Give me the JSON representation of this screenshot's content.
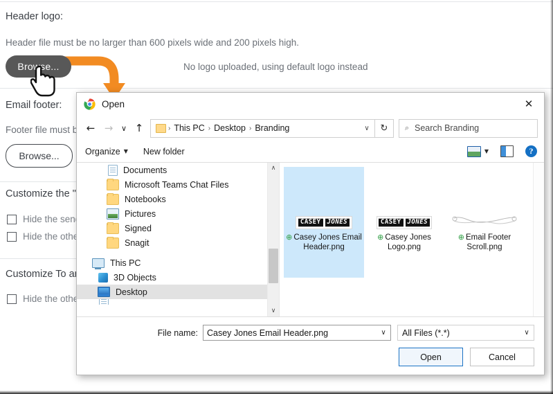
{
  "background_page": {
    "header_logo_label": "Header logo:",
    "header_help_text": "Header file must be no larger than 600 pixels wide and 200 pixels high.",
    "browse_header_label": "Browse...",
    "no_logo_text": "No logo uploaded, using default logo instead",
    "email_footer_label": "Email footer:",
    "footer_help_text": "Footer file must b",
    "browse_footer_label": "Browse...",
    "customize_section1_title": "Customize the \"",
    "checkbox1_label": "Hide the send",
    "checkbox2_label": "Hide the othe",
    "customize_section2_title": "Customize To ar",
    "checkbox3_label": "Hide the othe"
  },
  "dialog": {
    "title": "Open",
    "title_icon": "chrome-logo-icon",
    "close_icon": "✕",
    "nav": {
      "back_icon": "←",
      "forward_icon": "→",
      "recent_icon": "∨",
      "up_icon": "↑",
      "refresh_icon": "↻",
      "dropdown_icon": "∨",
      "breadcrumbs": [
        "This PC",
        "Desktop",
        "Branding"
      ],
      "crumb_separator": "›"
    },
    "search": {
      "icon": "⌕",
      "placeholder": "Search Branding"
    },
    "toolbar": {
      "organize_label": "Organize",
      "organize_caret": "▼",
      "new_folder_label": "New folder",
      "view_icon": "view-layout-icon",
      "view_caret": "▼",
      "preview_pane_icon": "preview-pane-icon",
      "help_icon": "?"
    },
    "nav_pane": {
      "items": [
        {
          "label": "Documents",
          "icon": "document-icon",
          "level": 2,
          "selected": false
        },
        {
          "label": "Microsoft Teams Chat Files",
          "icon": "folder-icon",
          "level": 2,
          "selected": false
        },
        {
          "label": "Notebooks",
          "icon": "folder-icon",
          "level": 2,
          "selected": false
        },
        {
          "label": "Pictures",
          "icon": "picture-folder-icon",
          "level": 2,
          "selected": false
        },
        {
          "label": "Signed",
          "icon": "folder-icon",
          "level": 2,
          "selected": false
        },
        {
          "label": "Snagit",
          "icon": "folder-icon",
          "level": 2,
          "selected": false
        },
        {
          "label": "This PC",
          "icon": "this-pc-icon",
          "level": 1,
          "selected": false
        },
        {
          "label": "3D Objects",
          "icon": "3d-objects-icon",
          "level": 2,
          "selected": false
        },
        {
          "label": "Desktop",
          "icon": "desktop-icon",
          "level": 2,
          "selected": true
        }
      ],
      "scroll_up_icon": "∧",
      "scroll_down_icon": "∨"
    },
    "files": [
      {
        "name": "Casey Jones Email Header.png",
        "selected": true,
        "thumb_type": "logo",
        "thumb_words": [
          "CASEY",
          "JONES"
        ],
        "status_icon": "⊕"
      },
      {
        "name": "Casey Jones Logo.png",
        "selected": false,
        "thumb_type": "logo",
        "thumb_words": [
          "CASEY",
          "JONES"
        ],
        "status_icon": "⊕"
      },
      {
        "name": "Email Footer Scroll.png",
        "selected": false,
        "thumb_type": "scroll",
        "thumb_words": [],
        "status_icon": "⊕"
      }
    ],
    "footer": {
      "file_name_label": "File name:",
      "file_name_value": "Casey Jones Email Header.png",
      "file_name_caret": "∨",
      "file_type_value": "All Files (*.*)",
      "file_type_caret": "∨",
      "open_label": "Open",
      "cancel_label": "Cancel"
    }
  },
  "annotation": {
    "arrow_color": "#F28B22",
    "cursor_icon": "pointing-hand-cursor"
  }
}
